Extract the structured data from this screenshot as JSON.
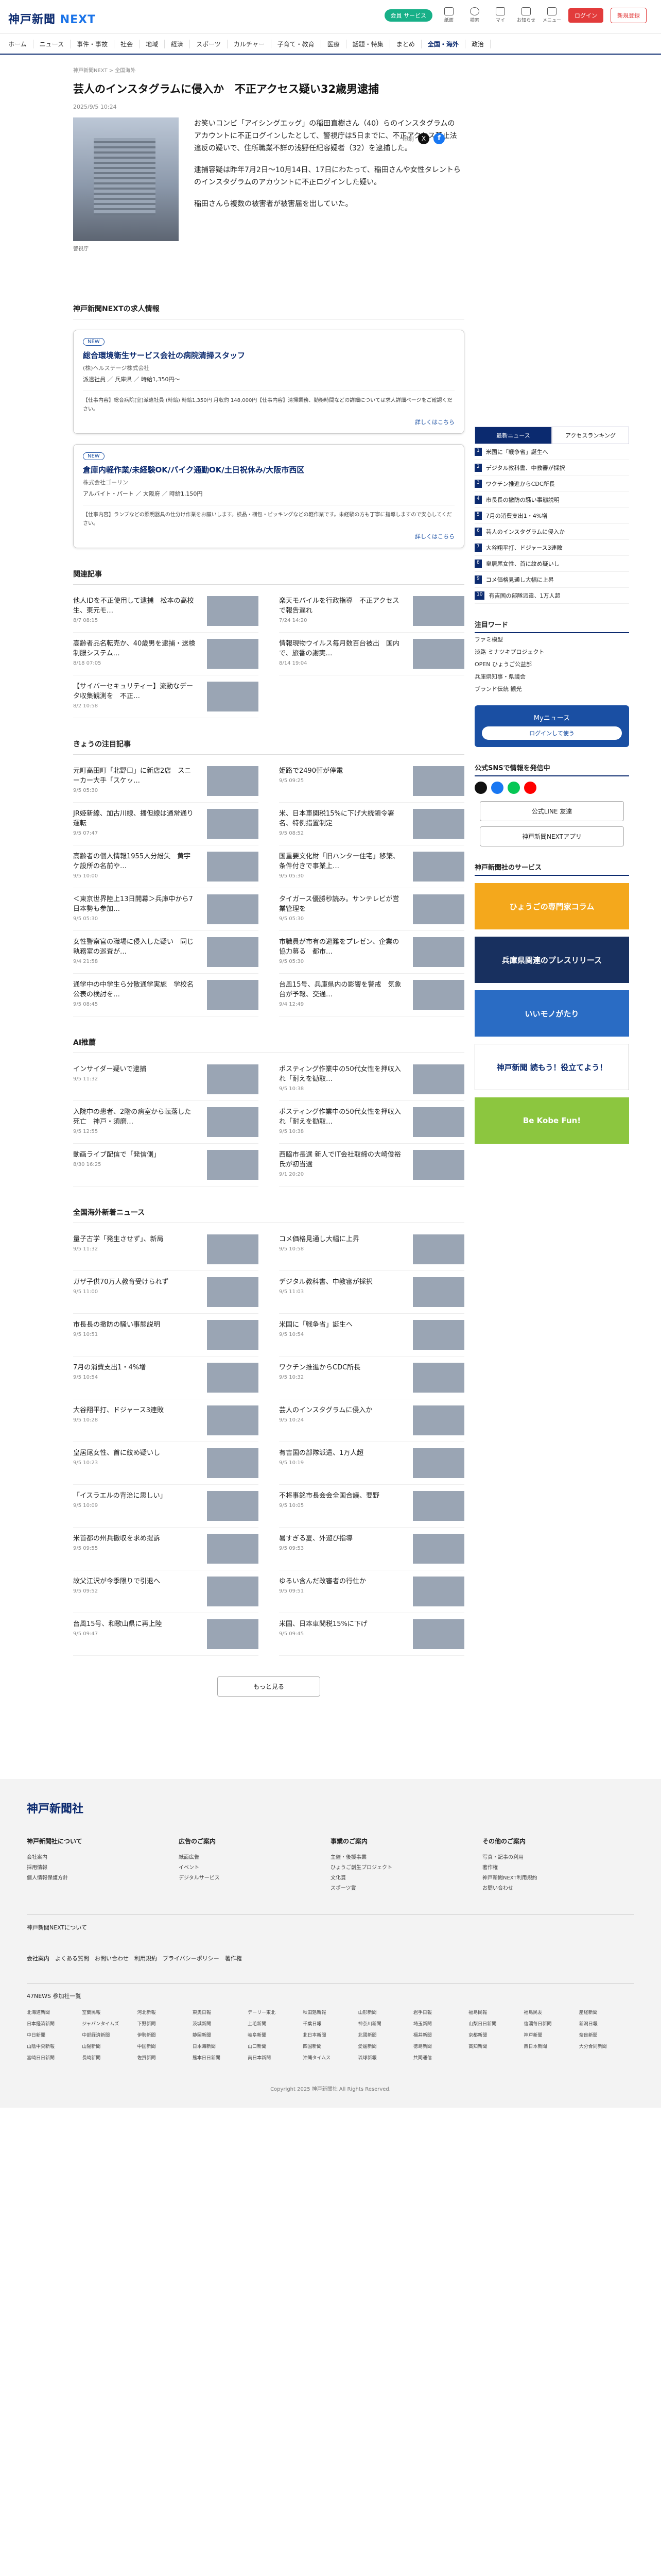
{
  "header": {
    "logo_main": "神戸新聞",
    "logo_next": "NEXT",
    "pill": "会員 サービス",
    "icons": [
      "紙面",
      "検索",
      "マイ",
      "お知らせ",
      "メニュー"
    ],
    "login": "ログイン",
    "register": "新規登録"
  },
  "nav": [
    "ホーム",
    "ニュース",
    "事件・事故",
    "社会",
    "地域",
    "経済",
    "スポーツ",
    "カルチャー",
    "子育て・教育",
    "医療",
    "話題・特集",
    "まとめ",
    "全国・海外",
    "政治"
  ],
  "article": {
    "breadcrumb": "神戸新聞NEXT > 全国海外",
    "title": "芸人のインスタグラムに侵入か　不正アクセス疑い32歳男逮捕",
    "date": "2025/9/5 10:24",
    "print": "印刷",
    "caption": "警視庁",
    "paras": [
      "お笑いコンビ「アイシングエッグ」の稲田直樹さん（40）らのインスタグラムのアカウントに不正ログインしたとして、警視庁は5日までに、不正アクセス禁止法違反の疑いで、住所職業不詳の浅野任紀容疑者（32）を逮捕した。",
      "逮捕容疑は昨年7月2日〜10月14日、17日にわたって、稲田さんや女性タレントらのインスタグラムのアカウントに不正ログインした疑い。",
      "稲田さんら複数の被害者が被害届を出していた。"
    ]
  },
  "jobs": {
    "title": "神戸新聞NEXTの求人情報",
    "items": [
      {
        "badge": "NEW",
        "title": "総合環境衛生サービス会社の病院清掃スタッフ",
        "co": "(株)ヘルステージ株式会社",
        "meta": "派遣社員 ／ 兵庫県 ／ 時給1,350円〜",
        "desc": "【仕事内容】総合病院(室)派遣社員 (時給) 時給1,350円 月収約 148,000円【仕事内容】清掃業務、勤務時間などの詳細については求人詳細ページをご確認ください。",
        "more": "詳しくはこちら"
      },
      {
        "badge": "NEW",
        "title": "倉庫内軽作業/未経験OK/バイク通勤OK/土日祝休み/大阪市西区",
        "co": "株式会社ゴーリン",
        "meta": "アルバイト・パート ／ 大阪府 ／ 時給1,150円",
        "desc": "【仕事内容】ランプなどの照明器具の仕分け作業をお願いします。検品・梱包・ピッキングなどの軽作業です。未経験の方も丁寧に指導しますので安心してください。",
        "more": "詳しくはこちら"
      }
    ]
  },
  "related": {
    "title": "関連記事",
    "items": [
      {
        "t": "他人IDを不正使用して逮捕　松本の高校生、東元モ…",
        "d": "8/7 08:15"
      },
      {
        "t": "楽天モバイルを行政指導　不正アクセスで報告遅れ",
        "d": "7/24 14:20"
      },
      {
        "t": "高齢者品名転売か、40歳男を逮捕・送検　制服システム…",
        "d": "8/18 07:05"
      },
      {
        "t": "情報現物ウイルス毎月数百台被出　国内で、旅番の謝実…",
        "d": "8/14 19:04"
      },
      {
        "t": "【サイバーセキュリティー】流動なデータ収集観測を　不正…",
        "d": "8/2 10:58"
      }
    ]
  },
  "today": {
    "title": "きょうの注目記事",
    "items": [
      {
        "t": "元町高田町「北野口」に新店2店　スニーカー大手「スケッ…",
        "d": "9/5 05:30"
      },
      {
        "t": "姫路で2490軒が停電",
        "d": "9/5 09:25"
      },
      {
        "t": "JR姫新線、加古川線、播但線は通常通り運転",
        "d": "9/5 07:47"
      },
      {
        "t": "米、日本車関税15%に下げ大統領令署名、特例措置制定",
        "d": "9/5 08:52"
      },
      {
        "t": "高齢者の個人情報1955人分紛失　黄宇ケ設所の名前や…",
        "d": "9/5 10:00"
      },
      {
        "t": "国重要文化財「旧ハンター住宅」移築、条件付きで事業上…",
        "d": "9/5 05:30"
      },
      {
        "t": "＜東京世界陸上13日開幕＞兵庫中から7日本勢も参加…",
        "d": "9/5 05:30"
      },
      {
        "t": "タイガース優勝秒読み。サンテレビが営業管理を",
        "d": "9/5 05:30"
      },
      {
        "t": "女性警察官の職場に侵入した疑い　同じ執務室の巡査が…",
        "d": "9/4 21:58"
      },
      {
        "t": "市職員が市有の避難をプレゼン、企業の協力募る　都市…",
        "d": "9/5 05:30"
      },
      {
        "t": "通学中の中学生ら分散通学実施　学校名公表の検討を…",
        "d": "9/5 08:45"
      },
      {
        "t": "台風15号、兵庫県内の影響を警戒　気象台が予報、交通…",
        "d": "9/4 12:49"
      }
    ]
  },
  "ai": {
    "title": "AI推薦",
    "items": [
      {
        "t": "インサイダー疑いで逮捕",
        "d": "9/5 11:32"
      },
      {
        "t": "ポスティング作業中の50代女性を押収入れ「耐えを勧取…",
        "d": "9/5 10:38"
      },
      {
        "t": "入院中の患者、2階の病室から転落した死亡　神戸・須磨…",
        "d": "9/5 12:55"
      },
      {
        "t": "ポスティング作業中の50代女性を押収入れ「耐えを勧取…",
        "d": "9/5 10:38"
      },
      {
        "t": "動画ライブ配信で「発信側」",
        "d": "8/30 16:25"
      },
      {
        "t": "西脇市長選 新人でIT会社取締の大崎俊裕氏が初当選",
        "d": "9/1 20:20"
      }
    ]
  },
  "world": {
    "title": "全国海外新着ニュース",
    "items": [
      {
        "t": "量子古学「発生させず」、新局",
        "d": "9/5 11:32"
      },
      {
        "t": "コメ価格見通し大幅に上昇",
        "d": "9/5 10:58"
      },
      {
        "t": "ガザ子供70万人教育受けられず",
        "d": "9/5 11:00"
      },
      {
        "t": "デジタル教科書、中教審が採択",
        "d": "9/5 11:03"
      },
      {
        "t": "市長長の撤防の騒い事態説明",
        "d": "9/5 10:51"
      },
      {
        "t": "米国に「戦争省」誕生へ",
        "d": "9/5 10:54"
      },
      {
        "t": "7月の消費支出1・4%増",
        "d": "9/5 10:54"
      },
      {
        "t": "ワクチン推進からCDC所長",
        "d": "9/5 10:32"
      },
      {
        "t": "大谷翔平打、ドジャース3連敗",
        "d": "9/5 10:28"
      },
      {
        "t": "芸人のインスタグラムに侵入か",
        "d": "9/5 10:24"
      },
      {
        "t": "皇居尾女性、首に紋め疑いし",
        "d": "9/5 10:23"
      },
      {
        "t": "有吉国の部隊派遣、1万人超",
        "d": "9/5 10:19"
      },
      {
        "t": "「イスラエルの背治に思しい」",
        "d": "9/5 10:09"
      },
      {
        "t": "不将事銘市長会会全国合議、要野",
        "d": "9/5 10:05"
      },
      {
        "t": "米首都の州兵撤収を求め提訴",
        "d": "9/5 09:55"
      },
      {
        "t": "暑すぎる夏、外遊び指導",
        "d": "9/5 09:53"
      },
      {
        "t": "故父江沢が今季限りで引退へ",
        "d": "9/5 09:52"
      },
      {
        "t": "ゆるい含んだ改審者の行仕か",
        "d": "9/5 09:51"
      },
      {
        "t": "台風15号、和歌山県に再上陸",
        "d": "9/5 09:47"
      },
      {
        "t": "米国、日本車関税15%に下げ",
        "d": "9/5 09:45"
      }
    ]
  },
  "more_label": "もっと見る",
  "side": {
    "tabs": [
      "最新ニュース",
      "アクセスランキング"
    ],
    "ranking": [
      "米国に「戦争省」誕生へ",
      "デジタル教科書、中教審が採択",
      "ワクチン推進からCDC所長",
      "市長長の撤防の騒い事態説明",
      "7月の消費支出1・4%増",
      "芸人のインスタグラムに侵入か",
      "大谷翔平打、ドジャース3連敗",
      "皇居尾女性、首に紋め疑いし",
      "コメ価格見通し大幅に上昇",
      "有吉国の部隊派遣、1万人超"
    ],
    "watch_title": "注目ワード",
    "words": [
      "ファミ模型",
      "淡路 ミナツキプロジェクト",
      "OPEN ひょうご公益部",
      "兵庫県知事・県議会",
      "ブランド伝統 観光"
    ],
    "my_title": "Myニュース",
    "my_login": "ログインして使う",
    "sns_title": "公式SNSで情報を発信中",
    "follow": "公式LINE 友達",
    "app": "神戸新聞NEXTアプリ",
    "services_title": "神戸新聞社のサービス",
    "banner1": "ひょうごの専門家コラム",
    "banner2": "兵庫県関連のプレスリリース",
    "banner3": "いいモノがたり",
    "banner4": "神戸新聞 読もう！役立てよう！",
    "banner5": "Be Kobe Fun!"
  },
  "footer": {
    "logo": "神戸新聞社",
    "cols": [
      {
        "h": "神戸新聞社について",
        "items": [
          "会社案内",
          "採用情報",
          "個人情報保護方針"
        ]
      },
      {
        "h": "広告のご案内",
        "items": [
          "紙面広告",
          "イベント",
          "デジタルサービス"
        ]
      },
      {
        "h": "事業のご案内",
        "items": [
          "主催・後援事業",
          "ひょうご創生プロジェクト",
          "文化賞",
          "スポーツ賞"
        ]
      },
      {
        "h": "その他のご案内",
        "items": [
          "写真・記事の利用",
          "著作権",
          "神戸新聞NEXT利用規約",
          "お問い合わせ"
        ]
      }
    ],
    "next_label": "神戸新聞NEXTについて",
    "links": "会社案内　よくある質問　お問い合わせ　利用規約　プライバシーポリシー　著作権",
    "news47": "47NEWS 参加社一覧",
    "tags": [
      "北海道新聞",
      "室蘭民報",
      "河北新報",
      "東奥日報",
      "デーリー東北",
      "秋田魁新報",
      "山形新聞",
      "岩手日報",
      "福島民報",
      "福島民友",
      "産経新聞",
      "日本経済新聞",
      "ジャパンタイムズ",
      "下野新聞",
      "茨城新聞",
      "上毛新聞",
      "千葉日報",
      "神奈川新聞",
      "埼玉新聞",
      "山梨日日新聞",
      "信濃毎日新聞",
      "新潟日報",
      "中日新聞",
      "中部経済新聞",
      "伊勢新聞",
      "静岡新聞",
      "岐阜新聞",
      "北日本新聞",
      "北國新聞",
      "福井新聞",
      "京都新聞",
      "神戸新聞",
      "奈良新聞",
      "山陰中央新報",
      "山陽新聞",
      "中国新聞",
      "日本海新聞",
      "山口新聞",
      "四国新聞",
      "愛媛新聞",
      "徳島新聞",
      "高知新聞",
      "西日本新聞",
      "大分合同新聞",
      "宮崎日日新聞",
      "長崎新聞",
      "佐賀新聞",
      "熊本日日新聞",
      "南日本新聞",
      "沖縄タイムス",
      "琉球新報",
      "共同通信"
    ],
    "copy": "Copyright 2025 神戸新聞社 All Rights Reserved."
  }
}
